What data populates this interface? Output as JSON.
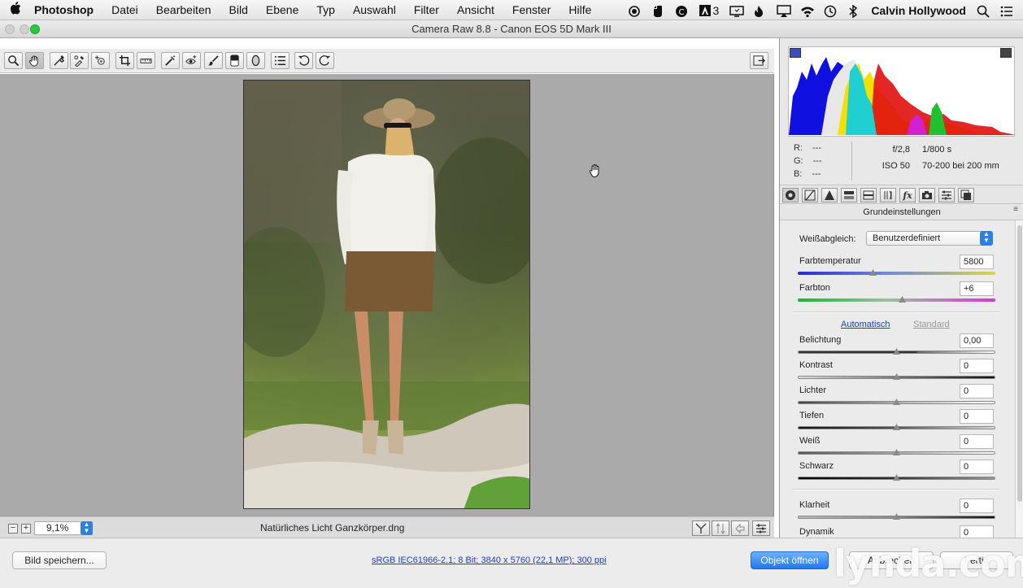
{
  "menubar": {
    "app": "Photoshop",
    "items": [
      "Datei",
      "Bearbeiten",
      "Bild",
      "Ebene",
      "Typ",
      "Auswahl",
      "Filter",
      "Ansicht",
      "Fenster",
      "Hilfe"
    ],
    "adobe_count": "3",
    "user": "Calvin Hollywood"
  },
  "window": {
    "title": "Camera Raw 8.8 - Canon EOS 5D Mark III"
  },
  "toolbar": {
    "tools": [
      "zoom-tool-icon",
      "hand-tool-icon",
      "white-balance-tool-icon",
      "color-sampler-tool-icon",
      "targeted-adjustment-tool-icon",
      "crop-tool-icon",
      "straighten-tool-icon",
      "spot-removal-tool-icon",
      "red-eye-removal-icon",
      "adjustment-brush-icon",
      "graduated-filter-icon",
      "radial-filter-icon",
      "preferences-icon",
      "rotate-left-icon",
      "rotate-right-icon"
    ],
    "active_tool": "hand-tool-icon"
  },
  "preview": {
    "zoom": "9,1%",
    "filename": "Natürliches Licht Ganzkörper.dng"
  },
  "histogram": {
    "rgb_labels": [
      "R:",
      "G:",
      "B:"
    ],
    "rgb_values": [
      "---",
      "---",
      "---"
    ],
    "aperture": "f/2,8",
    "shutter": "1/800 s",
    "iso": "ISO 50",
    "lens": "70-200 bei 200 mm"
  },
  "panel": {
    "title": "Grundeinstellungen",
    "wb_label": "Weißabgleich:",
    "wb_value": "Benutzerdefiniert",
    "temp_label": "Farbtemperatur",
    "temp_value": "5800",
    "tint_label": "Farbton",
    "tint_value": "+6",
    "auto_label": "Automatisch",
    "default_label": "Standard",
    "sliders": [
      {
        "label": "Belichtung",
        "value": "0,00"
      },
      {
        "label": "Kontrast",
        "value": "0"
      },
      {
        "label": "Lichter",
        "value": "0"
      },
      {
        "label": "Tiefen",
        "value": "0"
      },
      {
        "label": "Weiß",
        "value": "0"
      },
      {
        "label": "Schwarz",
        "value": "0"
      },
      {
        "label": "Klarheit",
        "value": "0"
      },
      {
        "label": "Dynamik",
        "value": "0"
      }
    ]
  },
  "bottom": {
    "save_label": "Bild speichern...",
    "workflow": "sRGB IEC61966-2.1; 8 Bit; 3840 x 5760 (22,1 MP); 300 ppi",
    "open_label": "Objekt öffnen",
    "cancel_label": "Abbrechen",
    "done_label": "Fertig",
    "watermark": "lynda.com"
  },
  "colors": {
    "accent": "#2d7fe0",
    "link": "#1b3bd0",
    "close_green": "#2bc840"
  }
}
